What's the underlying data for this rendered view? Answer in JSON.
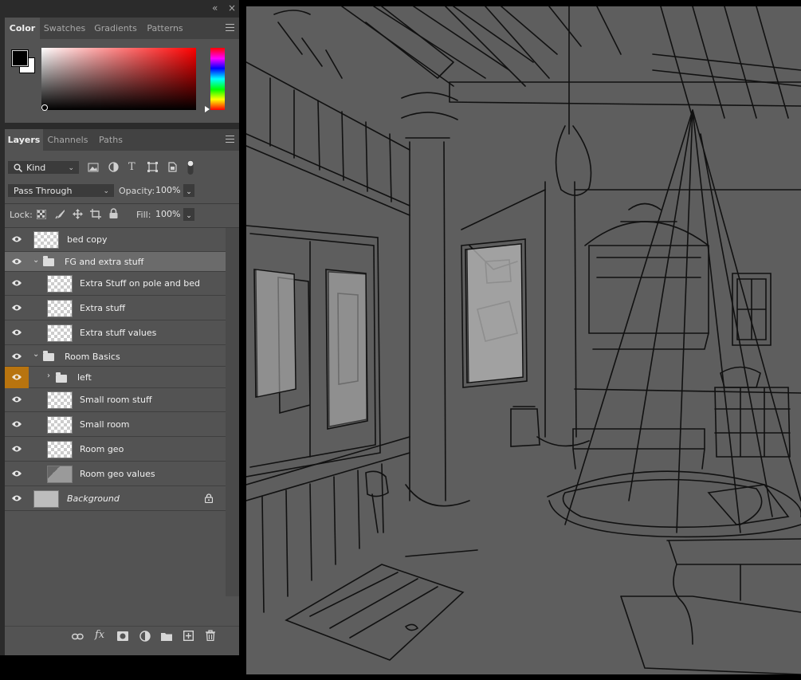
{
  "window": {
    "collapse_glyph": "«",
    "close_glyph": "×"
  },
  "color_panel": {
    "tabs": [
      "Color",
      "Swatches",
      "Gradients",
      "Patterns"
    ],
    "active_tab": "Color",
    "foreground": "#000000",
    "background": "#ffffff",
    "hue": "#ff0000"
  },
  "layers_panel": {
    "tabs": [
      "Layers",
      "Channels",
      "Paths"
    ],
    "active_tab": "Layers",
    "filter": {
      "value": "Kind"
    },
    "blend_mode": "Pass Through",
    "opacity_label": "Opacity:",
    "opacity": "100%",
    "lock_label": "Lock:",
    "fill_label": "Fill:",
    "fill": "100%",
    "layers": [
      {
        "name": "bed copy"
      },
      {
        "name": "FG and extra stuff"
      },
      {
        "name": "Extra Stuff on pole and bed"
      },
      {
        "name": "Extra stuff"
      },
      {
        "name": "Extra stuff values"
      },
      {
        "name": "Room Basics"
      },
      {
        "name": "left"
      },
      {
        "name": "Small room stuff"
      },
      {
        "name": "Small room"
      },
      {
        "name": "Room geo"
      },
      {
        "name": "Room geo values"
      },
      {
        "name": "Background"
      }
    ],
    "bottom_icons": [
      "link-icon",
      "fx-icon",
      "mask-icon",
      "adjustment-icon",
      "group-icon",
      "new-layer-icon",
      "trash-icon"
    ]
  },
  "colors": {
    "highlight": "#b8740f",
    "panel": "#535353",
    "canvas": "#5e5e5e"
  }
}
